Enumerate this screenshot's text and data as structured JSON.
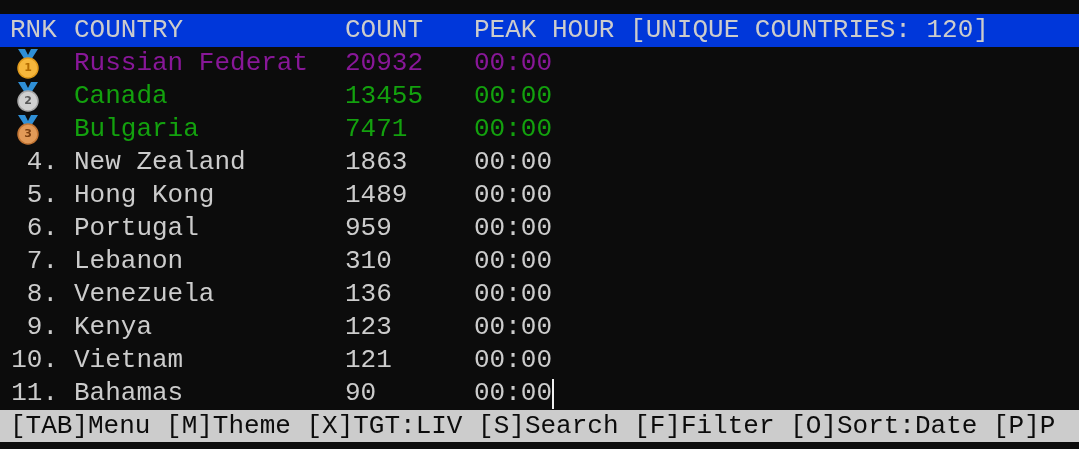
{
  "table": {
    "columns": [
      {
        "label": "RNK"
      },
      {
        "label": "COUNTRY"
      },
      {
        "label": "COUNT"
      },
      {
        "label": "PEAK HOUR [UNIQUE COUNTRIES: 120]"
      }
    ],
    "rows": [
      {
        "kind": "gold_medal",
        "rank": "1",
        "country": "Russian Federat",
        "count": "20932",
        "peak": "00:00",
        "color": "#881798",
        "cursor": false
      },
      {
        "kind": "silver_medal",
        "rank": "2",
        "country": "Canada",
        "count": "13455",
        "peak": "00:00",
        "color": "#13a10e",
        "cursor": false
      },
      {
        "kind": "bronze_medal",
        "rank": "3",
        "country": "Bulgaria",
        "count": "7471",
        "peak": "00:00",
        "color": "#13a10e",
        "cursor": false
      },
      {
        "kind": "plain",
        "rank": "4.",
        "country": "New Zealand",
        "count": "1863",
        "peak": "00:00",
        "color": "#cccccc",
        "cursor": false
      },
      {
        "kind": "plain",
        "rank": "5.",
        "country": "Hong Kong",
        "count": "1489",
        "peak": "00:00",
        "color": "#cccccc",
        "cursor": false
      },
      {
        "kind": "plain",
        "rank": "6.",
        "country": "Portugal",
        "count": "959",
        "peak": "00:00",
        "color": "#cccccc",
        "cursor": false
      },
      {
        "kind": "plain",
        "rank": "7.",
        "country": "Lebanon",
        "count": "310",
        "peak": "00:00",
        "color": "#cccccc",
        "cursor": false
      },
      {
        "kind": "plain",
        "rank": "8.",
        "country": "Venezuela",
        "count": "136",
        "peak": "00:00",
        "color": "#cccccc",
        "cursor": false
      },
      {
        "kind": "plain",
        "rank": "9.",
        "country": "Kenya",
        "count": "123",
        "peak": "00:00",
        "color": "#cccccc",
        "cursor": false
      },
      {
        "kind": "plain",
        "rank": "10.",
        "country": "Vietnam",
        "count": "121",
        "peak": "00:00",
        "color": "#cccccc",
        "cursor": false
      },
      {
        "kind": "plain",
        "rank": "11.",
        "country": "Bahamas",
        "count": "90",
        "peak": "00:00",
        "color": "#cccccc",
        "cursor": true
      }
    ]
  },
  "status_bar": {
    "text": "[TAB]Menu [M]Theme [X]TGT:LIV [S]Search [F]Filter [O]Sort:Date [P]P"
  }
}
